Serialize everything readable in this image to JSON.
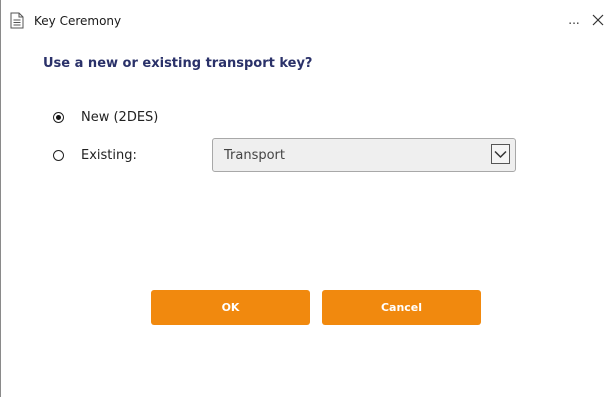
{
  "window": {
    "title": "Key Ceremony",
    "more_label": "...",
    "icons": {
      "app": "document-icon",
      "close": "close-icon"
    }
  },
  "prompt": {
    "question": "Use a new or existing transport key?"
  },
  "options": {
    "new": {
      "label": "New (2DES)",
      "selected": true
    },
    "existing": {
      "label": "Existing:",
      "selected": false
    }
  },
  "transport_select": {
    "value": "Transport",
    "enabled": false,
    "icon": "chevron-down-icon"
  },
  "buttons": {
    "ok_label": "OK",
    "cancel_label": "Cancel"
  },
  "colors": {
    "accent": "#f1890e",
    "heading": "#2a3169"
  }
}
